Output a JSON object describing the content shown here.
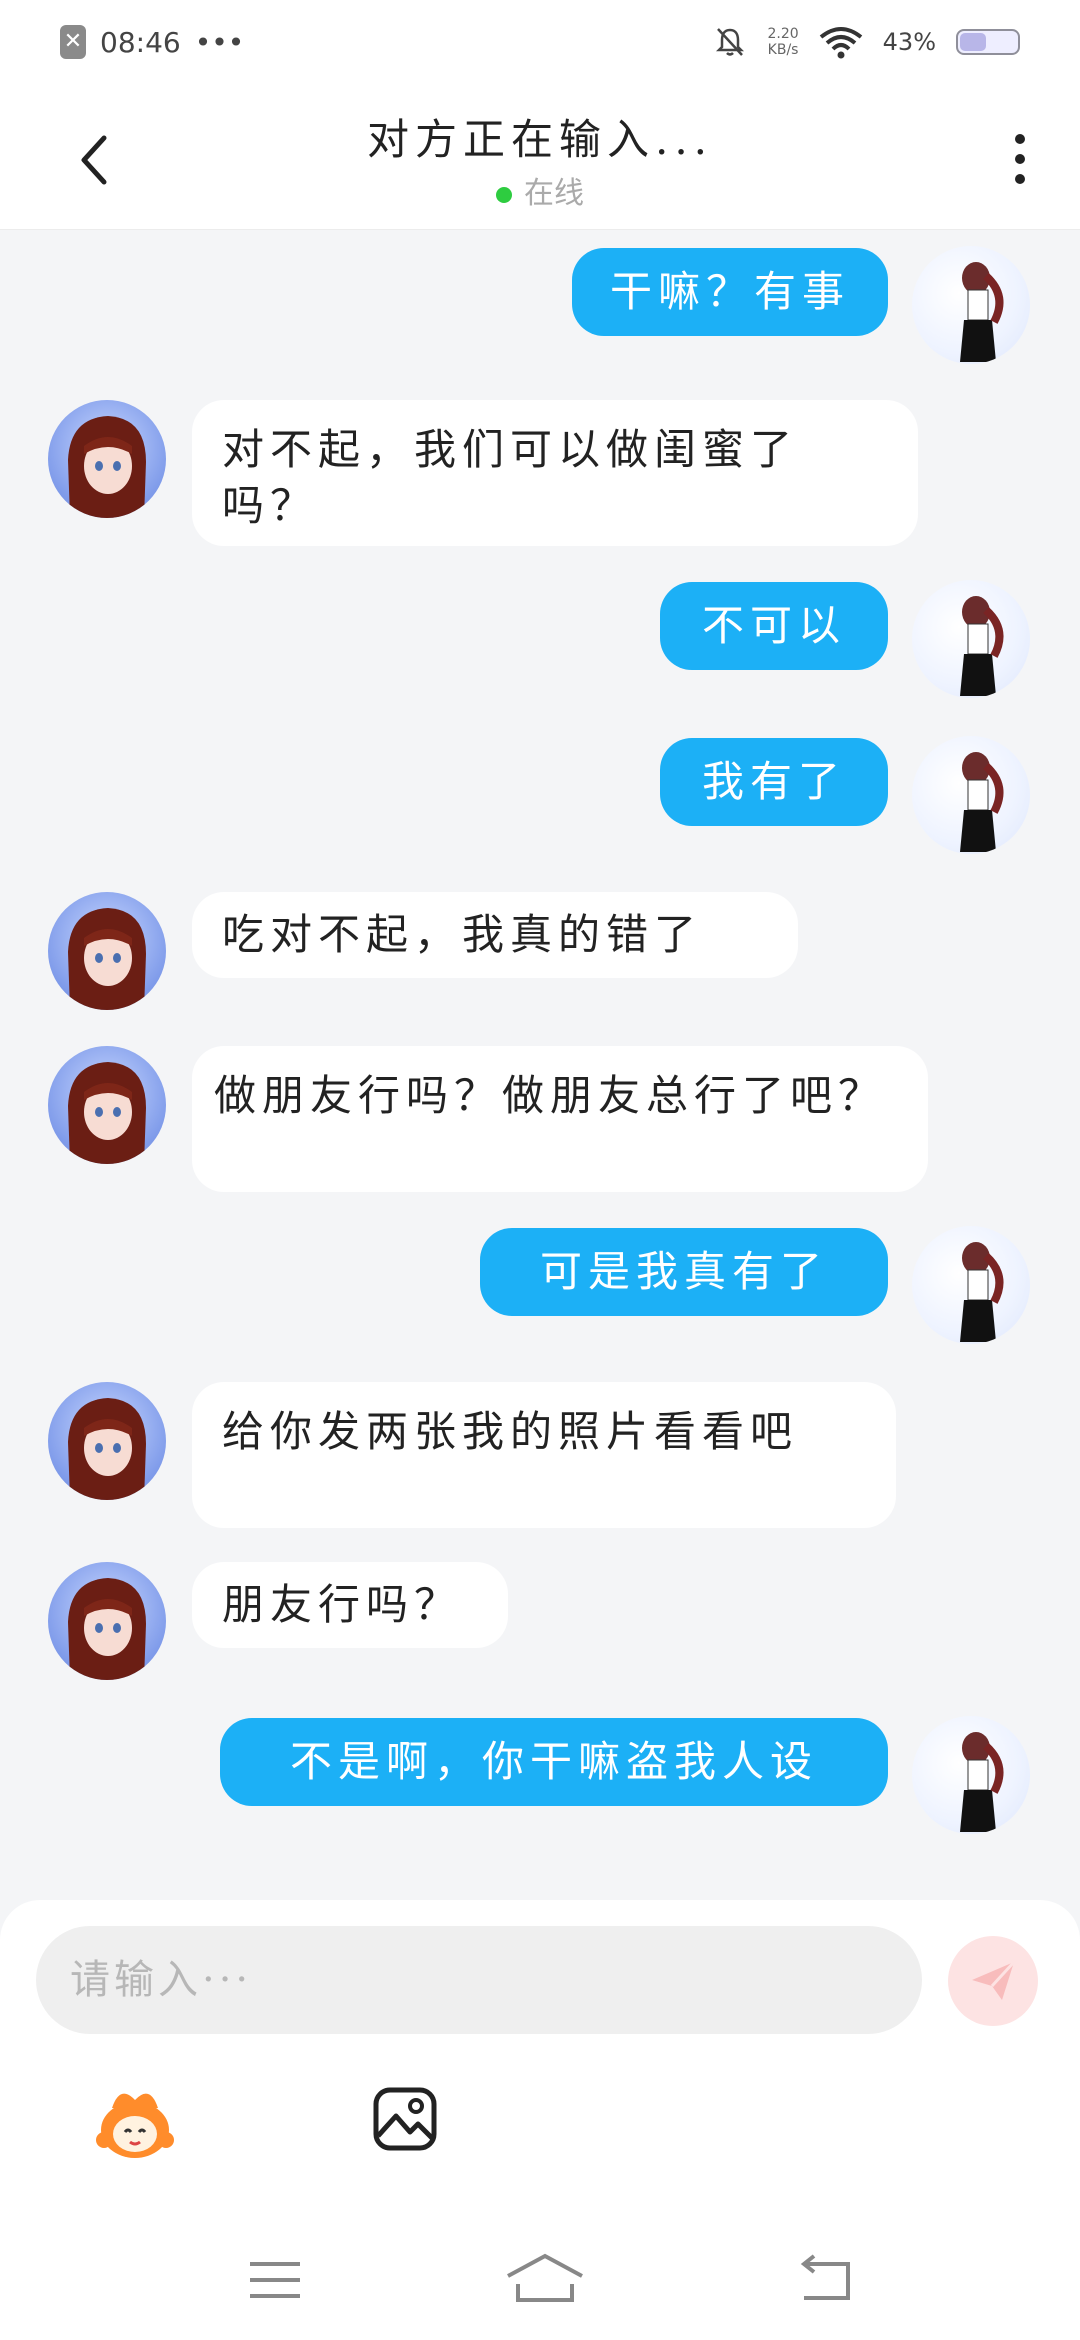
{
  "status_bar": {
    "time": "08:46",
    "dots": "•••",
    "net_speed_top": "2.20",
    "net_speed_bottom": "KB/s",
    "battery_text": "43%",
    "battery_level": 0.43
  },
  "header": {
    "title": "对方正在输入...",
    "presence": "在线",
    "presence_color": "#2ecc40"
  },
  "messages": [
    {
      "from": "me",
      "text": "干嘛？有事"
    },
    {
      "from": "them",
      "text": "对不起，我们可以做闺蜜了吗？"
    },
    {
      "from": "me",
      "text": "不可以"
    },
    {
      "from": "me",
      "text": "我有了"
    },
    {
      "from": "them",
      "text": "吃对不起，我真的错了"
    },
    {
      "from": "them",
      "text": "做朋友行吗？做朋友总行了吧？"
    },
    {
      "from": "me",
      "text": "可是我真有了"
    },
    {
      "from": "them",
      "text": "给你发两张我的照片看看吧"
    },
    {
      "from": "them",
      "text": "朋友行吗？"
    },
    {
      "from": "me",
      "text": "不是啊，你干嘛盗我人设"
    }
  ],
  "composer": {
    "placeholder": "请输入···",
    "value": ""
  },
  "icons": {
    "back": "chevron-left-icon",
    "more": "more-vertical-icon",
    "send": "send-icon",
    "sticker": "sticker-icon",
    "image": "image-icon",
    "nav_menu": "menu-icon",
    "nav_home": "home-icon",
    "nav_back": "back-icon"
  },
  "colors": {
    "my_bubble": "#1cb0f6",
    "their_bubble": "#ffffff",
    "background": "#f4f5f7"
  }
}
